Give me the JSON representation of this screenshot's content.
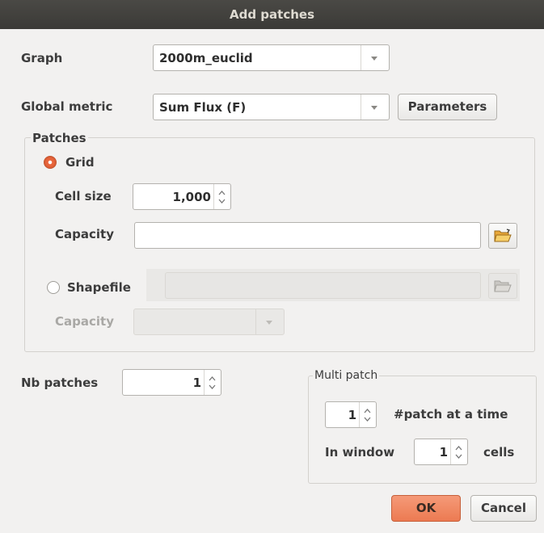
{
  "window": {
    "title": "Add patches"
  },
  "graph": {
    "label": "Graph",
    "value": "2000m_euclid"
  },
  "global_metric": {
    "label": "Global metric",
    "value": "Sum Flux (F)",
    "parameters_label": "Parameters"
  },
  "patches": {
    "title": "Patches",
    "grid": {
      "label": "Grid",
      "selected": true
    },
    "cell_size": {
      "label": "Cell size",
      "value": "1,000"
    },
    "capacity": {
      "label": "Capacity",
      "value": ""
    },
    "shapefile": {
      "label": "Shapefile",
      "selected": false,
      "value": ""
    },
    "shape_capacity": {
      "label": "Capacity",
      "value": ""
    }
  },
  "nb_patches": {
    "label": "Nb patches",
    "value": "1"
  },
  "multi_patch": {
    "title": "Multi patch",
    "patch_at_time": {
      "value": "1",
      "label": "#patch at a time"
    },
    "in_window": {
      "label": "In window",
      "value": "1",
      "unit": "cells"
    }
  },
  "buttons": {
    "ok": "OK",
    "cancel": "Cancel"
  },
  "colors": {
    "accent": "#ec7a52",
    "titlebar": "#3b3a37",
    "background": "#f2f1f0"
  }
}
